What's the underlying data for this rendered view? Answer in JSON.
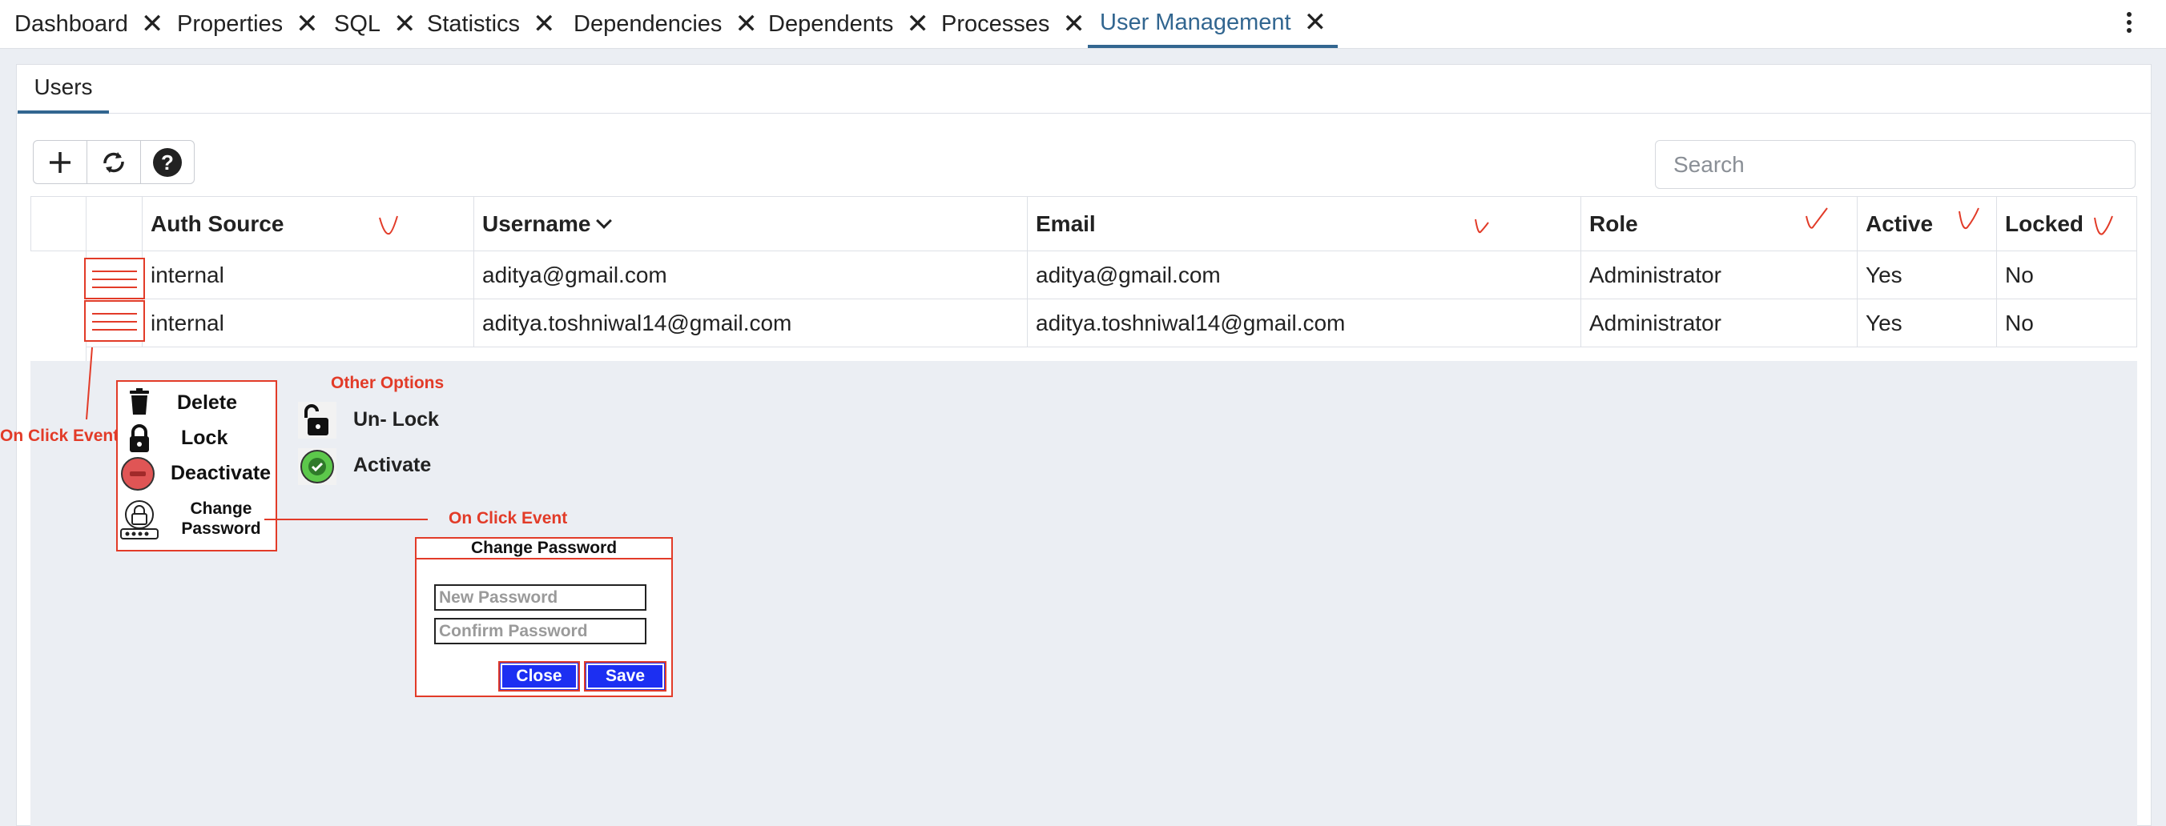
{
  "tabs": [
    {
      "label": "Dashboard",
      "active": false
    },
    {
      "label": "Properties",
      "active": false
    },
    {
      "label": "SQL",
      "active": false
    },
    {
      "label": "Statistics",
      "active": false
    },
    {
      "label": "Dependencies",
      "active": false
    },
    {
      "label": "Dependents",
      "active": false
    },
    {
      "label": "Processes",
      "active": false
    },
    {
      "label": "User Management",
      "active": true
    }
  ],
  "subtab": {
    "label": "Users"
  },
  "toolbar": {
    "add_icon": "plus-icon",
    "refresh_icon": "refresh-icon",
    "help_icon": "help-icon"
  },
  "search": {
    "placeholder": "Search",
    "value": ""
  },
  "table": {
    "columns": [
      "Auth Source",
      "Username",
      "Email",
      "Role",
      "Active",
      "Locked"
    ],
    "sorted_column": "Username",
    "rows": [
      {
        "auth_source": "internal",
        "username": "aditya@gmail.com",
        "email": "aditya@gmail.com",
        "role": "Administrator",
        "active": "Yes",
        "locked": "No"
      },
      {
        "auth_source": "internal",
        "username": "aditya.toshniwal14@gmail.com",
        "email": "aditya.toshniwal14@gmail.com",
        "role": "Administrator",
        "active": "Yes",
        "locked": "No"
      }
    ]
  },
  "annotations": {
    "on_click_event_1": "On Click Event",
    "on_click_event_2": "On Click Event",
    "other_options": "Other Options",
    "color": "#e23b28"
  },
  "row_menu": {
    "items": [
      "Delete",
      "Lock",
      "Deactivate"
    ],
    "change_password_line1": "Change",
    "change_password_line2": "Password"
  },
  "other_options": {
    "items": [
      "Un- Lock",
      "Activate"
    ]
  },
  "dialog": {
    "title": "Change Password",
    "new_password_placeholder": "New Password",
    "confirm_password_placeholder": "Confirm Password",
    "close_label": "Close",
    "save_label": "Save",
    "button_color": "#1c2ff2"
  },
  "colors": {
    "accent": "#326690",
    "panel_bg": "#ebeef3",
    "annotation_red": "#e23b28",
    "activate_green": "#5cc84b",
    "deactivate_red": "#e05555"
  }
}
